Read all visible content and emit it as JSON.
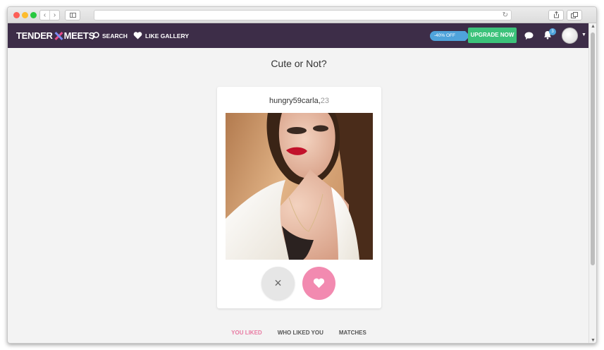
{
  "browser": {
    "url": "",
    "back_label": "‹",
    "forward_label": "›"
  },
  "navbar": {
    "logo_part1": "TENDER",
    "logo_part2": "MEETS",
    "search_label": "SEARCH",
    "gallery_label": "LIKE GALLERY",
    "promo_label": "-40% OFF",
    "upgrade_label": "UPGRADE NOW",
    "notification_count": "3",
    "colors": {
      "bar": "#3d2d48",
      "upgrade": "#3cc27a",
      "promo": "#4fa3db",
      "accent_pink": "#e87aa2"
    }
  },
  "main": {
    "title": "Cute or Not?",
    "profile": {
      "username": "hungry59carla,",
      "age": "23"
    },
    "dislike_symbol": "×",
    "like_icon": "heart-icon"
  },
  "tabs": [
    {
      "label": "YOU LIKED",
      "active": true
    },
    {
      "label": "WHO LIKED YOU",
      "active": false
    },
    {
      "label": "MATCHES",
      "active": false
    }
  ]
}
